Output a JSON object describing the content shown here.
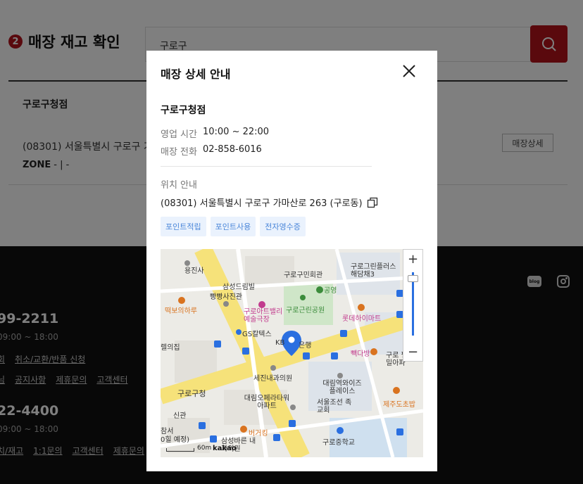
{
  "section": {
    "number": "2",
    "title": "매장 재고 확인"
  },
  "search": {
    "value": "구로구"
  },
  "store_list": {
    "name": "구로구청점",
    "address": "(08301) 서울특별시 구로구 가",
    "zone_label": "ZONE",
    "zone_value": "- | -",
    "detail_button": "매장상세"
  },
  "footer": {
    "phone1": "99-2211",
    "hours1": "09:00 ~ 18:00",
    "links1": [
      "회",
      "취소/교환/반품 신청"
    ],
    "links2": [
      "님",
      "공지사항",
      "제휴문의",
      "고객센터"
    ],
    "phone2": "22-4400",
    "hours2": "09:00 ~ 18:00",
    "links3": [
      "치/재고",
      "1:1문의",
      "고객센터",
      "제휴문의"
    ],
    "blog_label": "blog"
  },
  "modal": {
    "title": "매장 상세 안내",
    "store_name": "구로구청점",
    "hours_label": "영업 시간",
    "hours_value": "10:00 ~ 22:00",
    "phone_label": "매장 전화",
    "phone_value": "02-858-6016",
    "location_label": "위치 안내",
    "location_address": "(08301) 서울특별시 구로구 가마산로 263 (구로동)",
    "tags": [
      "포인트적립",
      "포인트사용",
      "전자영수증"
    ],
    "map": {
      "labels": {
        "l1": "용진사",
        "l2": "구로구민회관",
        "l3": "구로그린플러스 해담채3",
        "l4": "삼성드림빌",
        "l5": "빵빵사진관",
        "l6": "공영",
        "l7": "떡보의하루",
        "l8": "구로아트밸리 예술극장",
        "l9": "구로근린공원",
        "l10": "롯데하이마트",
        "l11": "GS칼텍스",
        "l12": "KB",
        "l13": "은행",
        "l14": "빽다방",
        "l15": "구로 펠라이밀아파",
        "l16": "세진내과의원",
        "l17": "구로구청",
        "l18": "대림역와이즈 플레이스",
        "l19": "대림오페라타워 아파트",
        "l20": "서울조선 족교회",
        "l21": "제주도초밥",
        "l22": "신관",
        "l23": "버거킹",
        "l24": "구로중학교",
        "l25": "삼성바른 내과의원",
        "l26": "0힐 예정)",
        "l27": "참서",
        "l28": "렐의집"
      },
      "scale": "60m",
      "brand": "kakao"
    }
  }
}
